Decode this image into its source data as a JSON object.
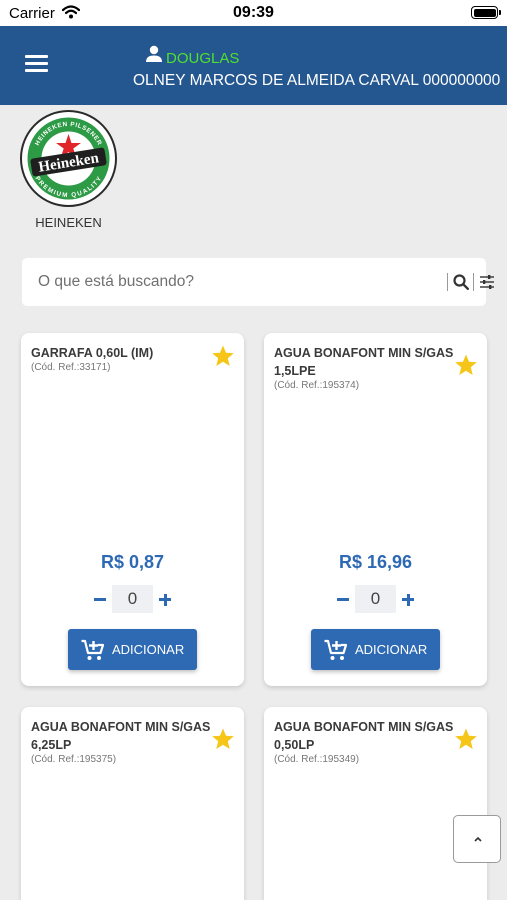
{
  "status_bar": {
    "carrier": "Carrier",
    "time": "09:39"
  },
  "header": {
    "user_name": "DOUGLAS",
    "company": "OLNEY MARCOS DE ALMEIDA CARVAL 000000000",
    "user_name_color": "#4fe02f",
    "background_color": "#24568f"
  },
  "brand": {
    "name": "HEINEKEN",
    "logo_text": "Heineken",
    "logo_ring_top": "HEINEKEN PILSENER",
    "logo_ring_bottom": "PREMIUM QUALITY"
  },
  "search": {
    "placeholder": "O que está buscando?",
    "value": ""
  },
  "products": [
    {
      "name": "GARRAFA 0,60L (IM)",
      "ref": "(Cód. Ref.:33171)",
      "price": "R$ 0,87",
      "quantity": "0",
      "add_label": "ADICIONAR",
      "favorite": true
    },
    {
      "name": "AGUA BONAFONT MIN S/GAS 1,5LPE",
      "ref": "(Cód. Ref.:195374)",
      "price": "R$ 16,96",
      "quantity": "0",
      "add_label": "ADICIONAR",
      "favorite": true
    },
    {
      "name": "AGUA BONAFONT MIN S/GAS 6,25LP",
      "ref": "(Cód. Ref.:195375)",
      "favorite": true
    },
    {
      "name": "AGUA BONAFONT MIN S/GAS 0,50LP",
      "ref": "(Cód. Ref.:195349)",
      "favorite": true
    }
  ],
  "colors": {
    "accent": "#2e69b3",
    "favorite_star": "#f5c518"
  },
  "icons": [
    "menu-icon",
    "user-icon",
    "search-icon",
    "filter-icon",
    "star-icon",
    "cart-add-icon",
    "chevron-up-icon"
  ]
}
